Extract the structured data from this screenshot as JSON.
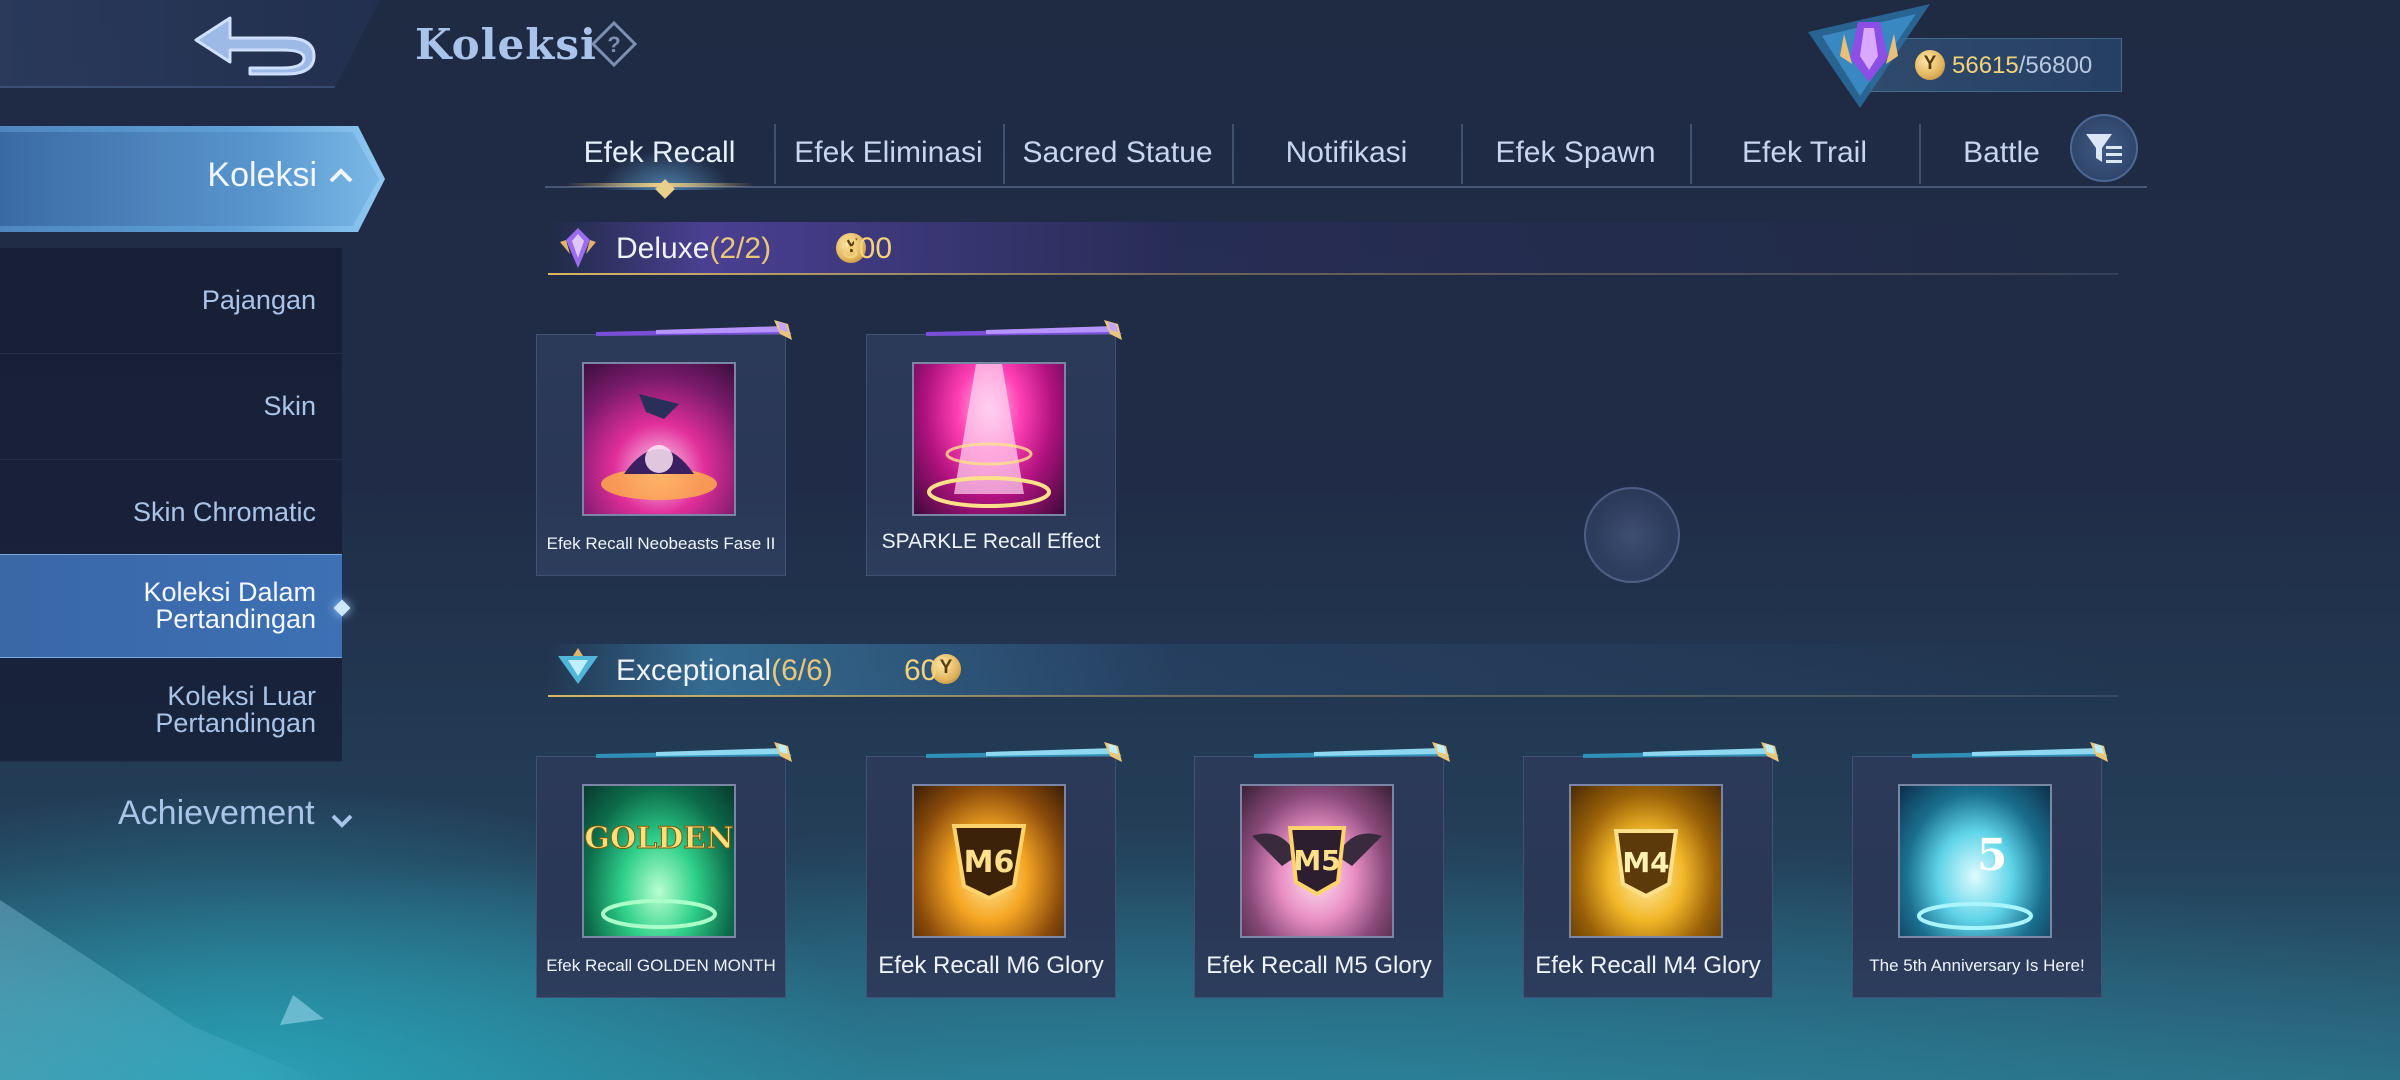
{
  "header": {
    "title": "Koleksi",
    "currency_current": "56615",
    "currency_sep": "/",
    "currency_max": "56800"
  },
  "sidebar": {
    "active": "Koleksi",
    "items": [
      {
        "label": "Pajangan"
      },
      {
        "label": "Skin"
      },
      {
        "label": "Skin Chromatic"
      },
      {
        "label": "Koleksi Dalam\nPertandingan",
        "selected": true
      },
      {
        "label": "Koleksi Luar\nPertandingan"
      }
    ],
    "achievement": "Achievement"
  },
  "tabs": [
    {
      "label": "Efek Recall",
      "active": true
    },
    {
      "label": "Efek Eliminasi"
    },
    {
      "label": "Sacred Statue"
    },
    {
      "label": "Notifikasi"
    },
    {
      "label": "Efek Spawn"
    },
    {
      "label": "Efek Trail"
    },
    {
      "label": "Battle"
    }
  ],
  "sections": {
    "deluxe": {
      "name": "Deluxe",
      "count": "(2/2)",
      "price": "300",
      "accent": "#9b6cf0",
      "cards": [
        {
          "label": "Efek Recall Neobeasts Fase II"
        },
        {
          "label": "SPARKLE Recall Effect"
        }
      ]
    },
    "exceptional": {
      "name": "Exceptional",
      "count": "(6/6)",
      "price": "60",
      "accent": "#4fb6d8",
      "cards": [
        {
          "label": "Efek Recall GOLDEN MONTH",
          "art_text": "GOLDEN"
        },
        {
          "label": "Efek Recall M6 Glory",
          "art_text": "M6"
        },
        {
          "label": "Efek Recall M5 Glory",
          "art_text": "M5"
        },
        {
          "label": "Efek Recall M4 Glory",
          "art_text": "M4"
        },
        {
          "label": "The 5th Anniversary Is Here!",
          "art_text": "5"
        }
      ]
    }
  },
  "colors": {
    "gold": "#f3d27a",
    "text": "#eef3fb",
    "tab_text": "#c7d6ee",
    "sidebar_text": "#a9c4e8",
    "selected_sidebar": "#3a67a6"
  }
}
